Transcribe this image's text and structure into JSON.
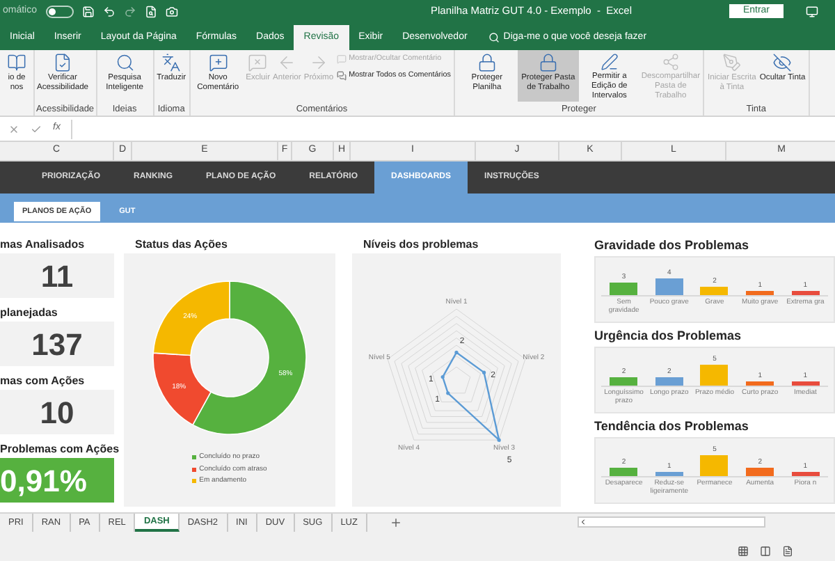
{
  "title_bar": {
    "autosave_label": "omático",
    "autosave_on": false,
    "title": "Planilha Matriz GUT 4.0 - Exemplo  -  Excel",
    "signin": "Entrar"
  },
  "ribbon_tabs": [
    {
      "label": "Inicial",
      "selected": false
    },
    {
      "label": "Inserir",
      "selected": false
    },
    {
      "label": "Layout da Página",
      "selected": false
    },
    {
      "label": "Fórmulas",
      "selected": false
    },
    {
      "label": "Dados",
      "selected": false
    },
    {
      "label": "Revisão",
      "selected": true
    },
    {
      "label": "Exibir",
      "selected": false
    },
    {
      "label": "Desenvolvedor",
      "selected": false
    }
  ],
  "tell_me": {
    "placeholder": "Diga-me o que você deseja fazer"
  },
  "ribbon_groups": [
    {
      "buttons": [
        {
          "kind": "large",
          "label": "io de nos",
          "disabled": false,
          "selected": false
        }
      ]
    },
    {
      "label": "Acessibilidade",
      "buttons": [
        {
          "kind": "large",
          "label": "Verificar Acessibilidade",
          "disabled": false,
          "selected": false
        }
      ]
    },
    {
      "label": "Ideias",
      "buttons": [
        {
          "kind": "large",
          "label": "Pesquisa Inteligente",
          "disabled": false,
          "selected": false
        }
      ]
    },
    {
      "label": "Idioma",
      "buttons": [
        {
          "kind": "large",
          "label": "Traduzir",
          "disabled": false,
          "selected": false
        }
      ]
    },
    {
      "label": "Comentários",
      "buttons": [
        {
          "kind": "large",
          "label": "Novo Comentário",
          "disabled": false,
          "selected": false
        },
        {
          "kind": "large",
          "label": "Excluir",
          "disabled": true,
          "selected": false
        },
        {
          "kind": "large",
          "label": "Anterior",
          "disabled": true,
          "selected": false
        },
        {
          "kind": "large",
          "label": "Próximo",
          "disabled": true,
          "selected": false
        },
        {
          "kind": "small",
          "label": "Mostrar/Ocultar Comentário",
          "disabled": true,
          "selected": false
        },
        {
          "kind": "small",
          "label": "Mostrar Todos os Comentários",
          "disabled": false,
          "selected": false
        }
      ]
    },
    {
      "label": "Proteger",
      "buttons": [
        {
          "kind": "large",
          "label": "Proteger Planilha",
          "disabled": false,
          "selected": false
        },
        {
          "kind": "large",
          "label": "Proteger Pasta de Trabalho",
          "disabled": false,
          "selected": true
        },
        {
          "kind": "large",
          "label": "Permitir a Edição de Intervalos",
          "disabled": false,
          "selected": false
        },
        {
          "kind": "large",
          "label": "Descompartilhar Pasta de Trabalho",
          "disabled": true,
          "selected": false
        }
      ]
    },
    {
      "label": "Tinta",
      "buttons": [
        {
          "kind": "large",
          "label": "Iniciar Escrita à Tinta",
          "disabled": true,
          "selected": false
        },
        {
          "kind": "large",
          "label": "Ocultar Tinta",
          "disabled": false,
          "selected": false
        }
      ]
    }
  ],
  "formula_bar": {
    "function_label": "fx"
  },
  "columns": [
    "C",
    "D",
    "E",
    "F",
    "G",
    "H",
    "I",
    "J",
    "K",
    "L",
    "M"
  ],
  "dashboard_nav": [
    {
      "label": "PRIORIZAÇÃO",
      "selected": false
    },
    {
      "label": "RANKING",
      "selected": false
    },
    {
      "label": "PLANO DE AÇÃO",
      "selected": false
    },
    {
      "label": "RELATÓRIO",
      "selected": false
    },
    {
      "label": "DASHBOARDS",
      "selected": true
    },
    {
      "label": "INSTRUÇÕES",
      "selected": false
    }
  ],
  "sub_nav": [
    {
      "label": "PLANOS DE AÇÃO",
      "selected": true
    },
    {
      "label": "GUT",
      "selected": false
    }
  ],
  "kpis": [
    {
      "title": "mas Analisados",
      "value": "11",
      "highlight": false
    },
    {
      "title": "planejadas",
      "value": "137",
      "highlight": false
    },
    {
      "title": "mas com Ações",
      "value": "10",
      "highlight": false
    },
    {
      "title": "Problemas com Ações",
      "value": "0,91%",
      "highlight": true
    }
  ],
  "status_chart": {
    "title": "Status das Ações",
    "chart_data": {
      "type": "donut",
      "categories": [
        "Concluído no prazo",
        "Concluído com atraso",
        "Em andamento"
      ],
      "values": [
        58,
        18,
        24
      ],
      "colors": [
        "#56b13f",
        "#f04a2f",
        "#f5b800"
      ],
      "value_labels": [
        "58%",
        "18%",
        "24%"
      ]
    }
  },
  "radar_chart": {
    "title": "Níveis dos problemas",
    "points": [
      {
        "axis": "Nível 1",
        "value": "2"
      },
      {
        "axis": "Nível 5",
        "value": "1"
      },
      {
        "axis": "Nível 2",
        "value": "2"
      },
      {
        "axis": "Nível 4",
        "value": "1"
      },
      {
        "axis": "Nível 3",
        "value": "5"
      }
    ]
  },
  "bar_charts": [
    {
      "title": "Gravidade dos Problemas",
      "chart_data": {
        "type": "bar",
        "categories": [
          "Sem gravidade",
          "Pouco grave",
          "Grave",
          "Muito grave",
          "Extrema gra"
        ],
        "values": [
          3,
          4,
          2,
          1,
          1
        ],
        "colors": [
          "#56b13f",
          "#6a9fd4",
          "#f5b800",
          "#f26b1d",
          "#e84c3d"
        ],
        "value_labels": [
          "3",
          "4",
          "2",
          "1",
          "1"
        ]
      }
    },
    {
      "title": "Urgência dos Problemas",
      "chart_data": {
        "type": "bar",
        "categories": [
          "Longuíssimo prazo",
          "Longo prazo",
          "Prazo médio",
          "Curto prazo",
          "Imediat"
        ],
        "values": [
          2,
          2,
          5,
          1,
          1
        ],
        "colors": [
          "#56b13f",
          "#6a9fd4",
          "#f5b800",
          "#f26b1d",
          "#e84c3d"
        ],
        "value_labels": [
          "2",
          "2",
          "5",
          "1",
          "1"
        ]
      }
    },
    {
      "title": "Tendência dos Problemas",
      "chart_data": {
        "type": "bar",
        "categories": [
          "Desaparece",
          "Reduz-se ligeiramente",
          "Permanece",
          "Aumenta",
          "Piora n"
        ],
        "values": [
          2,
          1,
          5,
          2,
          1
        ],
        "colors": [
          "#56b13f",
          "#6a9fd4",
          "#f5b800",
          "#f26b1d",
          "#e84c3d"
        ],
        "value_labels": [
          "2",
          "1",
          "5",
          "2",
          "1"
        ]
      }
    }
  ],
  "sheet_tabs": [
    {
      "label": "PRI",
      "selected": false
    },
    {
      "label": "RAN",
      "selected": false
    },
    {
      "label": "PA",
      "selected": false
    },
    {
      "label": "REL",
      "selected": false
    },
    {
      "label": "DASH",
      "selected": true
    },
    {
      "label": "DASH2",
      "selected": false
    },
    {
      "label": "INI",
      "selected": false
    },
    {
      "label": "DUV",
      "selected": false
    },
    {
      "label": "SUG",
      "selected": false
    },
    {
      "label": "LUZ",
      "selected": false
    }
  ]
}
